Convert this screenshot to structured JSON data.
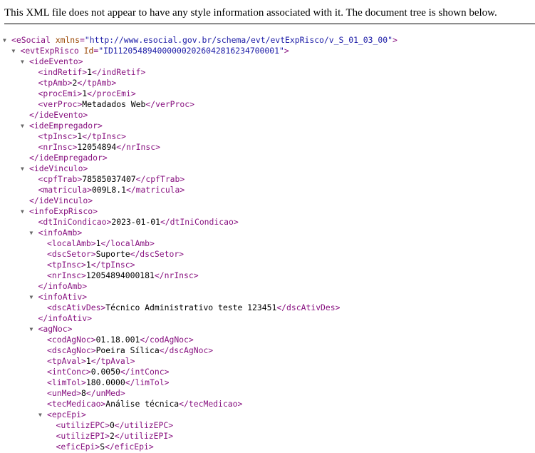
{
  "header": {
    "message": "This XML file does not appear to have any style information associated with it. The document tree is shown below."
  },
  "icons": {
    "expanded": "triangle-down-icon"
  },
  "colors": {
    "tag": "#881280",
    "attr_name": "#994500",
    "attr_value": "#1a1aa6",
    "text": "#000000"
  },
  "tree": [
    {
      "depth": 0,
      "toggle": true,
      "open": "<eSocial",
      "attr": "xmlns",
      "val": "\"http://www.esocial.gov.br/schema/evt/evtExpRisco/v_S_01_03_00\"",
      "close": ">"
    },
    {
      "depth": 1,
      "toggle": true,
      "open": "<evtExpRisco",
      "attr": "Id",
      "val": "\"ID1120548940000002026042816234700001\"",
      "close": ">"
    },
    {
      "depth": 2,
      "toggle": true,
      "open": "<ideEvento>"
    },
    {
      "depth": 3,
      "open": "<indRetif>",
      "text": "1",
      "close": "</indRetif>"
    },
    {
      "depth": 3,
      "open": "<tpAmb>",
      "text": "2",
      "close": "</tpAmb>"
    },
    {
      "depth": 3,
      "open": "<procEmi>",
      "text": "1",
      "close": "</procEmi>"
    },
    {
      "depth": 3,
      "open": "<verProc>",
      "text": "Metadados Web",
      "close": "</verProc>"
    },
    {
      "depth": 2,
      "open": "</ideEvento>"
    },
    {
      "depth": 2,
      "toggle": true,
      "open": "<ideEmpregador>"
    },
    {
      "depth": 3,
      "open": "<tpInsc>",
      "text": "1",
      "close": "</tpInsc>"
    },
    {
      "depth": 3,
      "open": "<nrInsc>",
      "text": "12054894",
      "close": "</nrInsc>"
    },
    {
      "depth": 2,
      "open": "</ideEmpregador>"
    },
    {
      "depth": 2,
      "toggle": true,
      "open": "<ideVinculo>"
    },
    {
      "depth": 3,
      "open": "<cpfTrab>",
      "text": "78585037407",
      "close": "</cpfTrab>"
    },
    {
      "depth": 3,
      "open": "<matricula>",
      "text": "009L8.1",
      "close": "</matricula>"
    },
    {
      "depth": 2,
      "open": "</ideVinculo>"
    },
    {
      "depth": 2,
      "toggle": true,
      "open": "<infoExpRisco>"
    },
    {
      "depth": 3,
      "open": "<dtIniCondicao>",
      "text": "2023-01-01",
      "close": "</dtIniCondicao>"
    },
    {
      "depth": 3,
      "toggle": true,
      "open": "<infoAmb>"
    },
    {
      "depth": 4,
      "open": "<localAmb>",
      "text": "1",
      "close": "</localAmb>"
    },
    {
      "depth": 4,
      "open": "<dscSetor>",
      "text": "Suporte",
      "close": "</dscSetor>"
    },
    {
      "depth": 4,
      "open": "<tpInsc>",
      "text": "1",
      "close": "</tpInsc>"
    },
    {
      "depth": 4,
      "open": "<nrInsc>",
      "text": "12054894000181",
      "close": "</nrInsc>"
    },
    {
      "depth": 3,
      "open": "</infoAmb>"
    },
    {
      "depth": 3,
      "toggle": true,
      "open": "<infoAtiv>"
    },
    {
      "depth": 4,
      "open": "<dscAtivDes>",
      "text": "Técnico Administrativo teste 123451",
      "close": "</dscAtivDes>"
    },
    {
      "depth": 3,
      "open": "</infoAtiv>"
    },
    {
      "depth": 3,
      "toggle": true,
      "open": "<agNoc>"
    },
    {
      "depth": 4,
      "open": "<codAgNoc>",
      "text": "01.18.001",
      "close": "</codAgNoc>"
    },
    {
      "depth": 4,
      "open": "<dscAgNoc>",
      "text": "Poeira Sílica",
      "close": "</dscAgNoc>"
    },
    {
      "depth": 4,
      "open": "<tpAval>",
      "text": "1",
      "close": "</tpAval>"
    },
    {
      "depth": 4,
      "open": "<intConc>",
      "text": "0.0050",
      "close": "</intConc>"
    },
    {
      "depth": 4,
      "open": "<limTol>",
      "text": "180.0000",
      "close": "</limTol>"
    },
    {
      "depth": 4,
      "open": "<unMed>",
      "text": "8",
      "close": "</unMed>"
    },
    {
      "depth": 4,
      "open": "<tecMedicao>",
      "text": "Análise técnica",
      "close": "</tecMedicao>"
    },
    {
      "depth": 4,
      "toggle": true,
      "open": "<epcEpi>"
    },
    {
      "depth": 5,
      "open": "<utilizEPC>",
      "text": "0",
      "close": "</utilizEPC>"
    },
    {
      "depth": 5,
      "open": "<utilizEPI>",
      "text": "2",
      "close": "</utilizEPI>"
    },
    {
      "depth": 5,
      "open": "<eficEpi>",
      "text": "S",
      "close": "</eficEpi>"
    }
  ]
}
